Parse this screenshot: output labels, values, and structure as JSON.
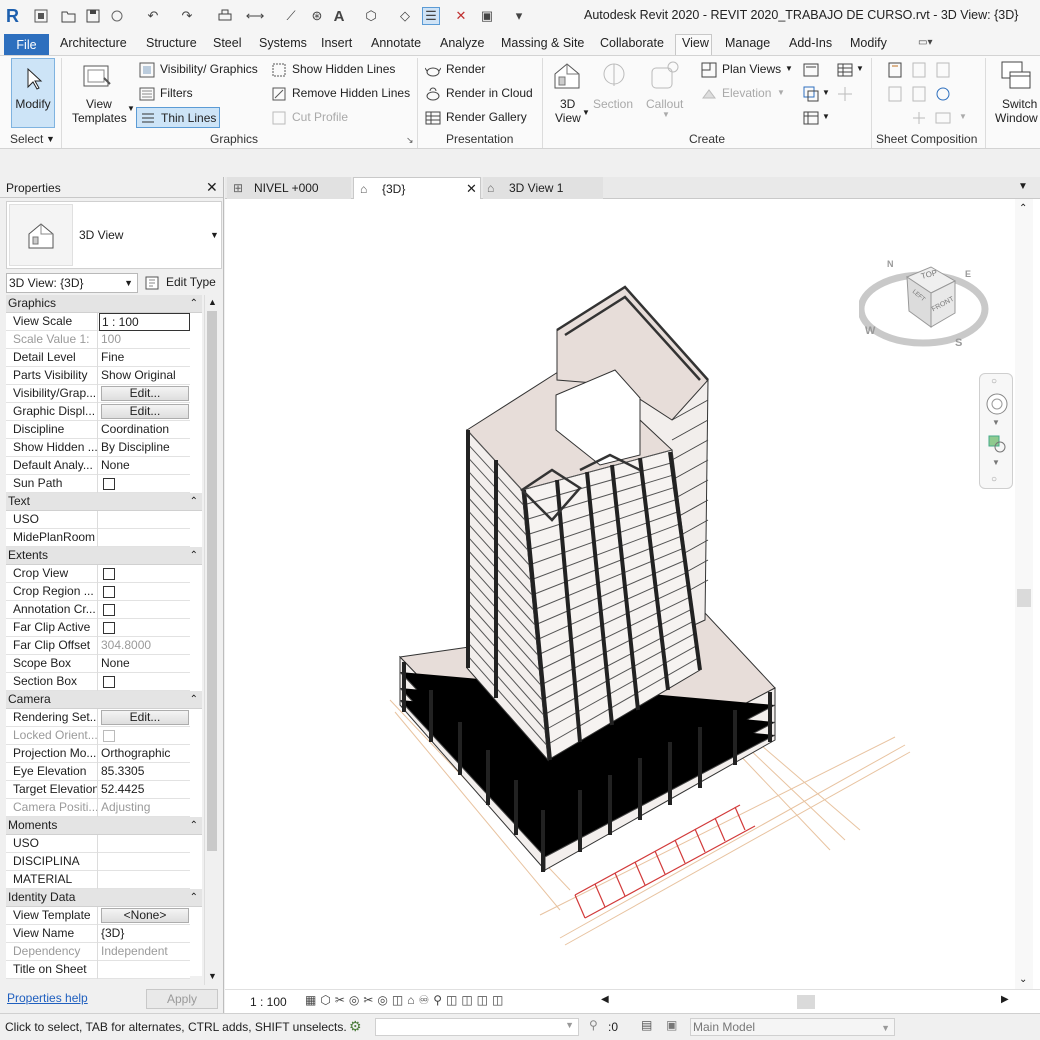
{
  "app": {
    "title": "Autodesk Revit 2020 - REVIT 2020_TRABAJO DE CURSO.rvt - 3D View: {3D}"
  },
  "ribbon_tabs": [
    "File",
    "Architecture",
    "Structure",
    "Steel",
    "Systems",
    "Insert",
    "Annotate",
    "Analyze",
    "Massing & Site",
    "Collaborate",
    "View",
    "Manage",
    "Add-Ins",
    "Modify"
  ],
  "ribbon": {
    "modify": "Modify",
    "select": "Select",
    "view_templates_1": "View",
    "view_templates_2": "Templates",
    "visibility_graphics": "Visibility/ Graphics",
    "filters": "Filters",
    "thin_lines": "Thin Lines",
    "show_hidden_lines": "Show  Hidden Lines",
    "remove_hidden_lines": "Remove  Hidden Lines",
    "cut_profile": "Cut  Profile",
    "graphics_panel": "Graphics",
    "render": "Render",
    "render_in_cloud": "Render  in Cloud",
    "render_gallery": "Render  Gallery",
    "presentation_panel": "Presentation",
    "view3d_1": "3D",
    "view3d_2": "View",
    "section": "Section",
    "callout": "Callout",
    "plan_views": "Plan  Views",
    "elevation": "Elevation",
    "create_panel": "Create",
    "sheet_composition": "Sheet Composition",
    "switch_1": "Switch",
    "switch_2": "Window"
  },
  "properties": {
    "title": "Properties",
    "type_name": "3D View",
    "selector": "3D View: {3D}",
    "edit_type": "Edit Type",
    "groups": {
      "graphics": "Graphics",
      "text": "Text",
      "extents": "Extents",
      "camera": "Camera",
      "moments": "Moments",
      "identity": "Identity Data"
    },
    "rows": {
      "view_scale": [
        "View Scale",
        "1 : 100"
      ],
      "scale_value": [
        "Scale Value    1:",
        "100"
      ],
      "detail_level": [
        "Detail Level",
        "Fine"
      ],
      "parts_visibility": [
        "Parts Visibility",
        "Show Original"
      ],
      "visibility_graphics": [
        "Visibility/Grap...",
        "Edit..."
      ],
      "graphic_display": [
        "Graphic Displ...",
        "Edit..."
      ],
      "discipline": [
        "Discipline",
        "Coordination"
      ],
      "show_hidden": [
        "Show Hidden ...",
        "By Discipline"
      ],
      "default_analysis": [
        "Default Analy...",
        "None"
      ],
      "sun_path": [
        "Sun Path",
        ""
      ],
      "uso": [
        "USO",
        ""
      ],
      "mideplan": [
        "MidePlanRoom",
        ""
      ],
      "crop_view": [
        "Crop View",
        ""
      ],
      "crop_region": [
        "Crop Region ...",
        ""
      ],
      "annotation_crop": [
        "Annotation Cr...",
        ""
      ],
      "far_clip_active": [
        "Far Clip Active",
        ""
      ],
      "far_clip_offset": [
        "Far Clip Offset",
        "304.8000"
      ],
      "scope_box": [
        "Scope Box",
        "None"
      ],
      "section_box": [
        "Section Box",
        ""
      ],
      "rendering_settings": [
        "Rendering Set...",
        "Edit..."
      ],
      "locked_orientation": [
        "Locked Orient...",
        ""
      ],
      "projection_mode": [
        "Projection Mo...",
        "Orthographic"
      ],
      "eye_elevation": [
        "Eye Elevation",
        "85.3305"
      ],
      "target_elevation": [
        "Target Elevation",
        "52.4425"
      ],
      "camera_position": [
        "Camera Positi...",
        "Adjusting"
      ],
      "m_uso": [
        "USO",
        ""
      ],
      "m_disciplina": [
        "DISCIPLINA",
        ""
      ],
      "m_material": [
        "MATERIAL",
        ""
      ],
      "view_template": [
        "View Template",
        "<None>"
      ],
      "view_name": [
        "View Name",
        "{3D}"
      ],
      "dependency": [
        "Dependency",
        "Independent"
      ],
      "title_on_sheet": [
        "Title on Sheet",
        ""
      ]
    },
    "help": "Properties help",
    "apply": "Apply"
  },
  "doc_tabs": [
    "NIVEL +000",
    "{3D}",
    "3D View 1"
  ],
  "view_controls": {
    "scale": "1 : 100"
  },
  "viewcube": {
    "top": "TOP",
    "front": "FRONT",
    "left": "LEFT",
    "n": "N",
    "e": "E",
    "s": "S",
    "w": "W"
  },
  "status": {
    "message": "Click to select, TAB for alternates, CTRL adds, SHIFT unselects.",
    "count": ":0",
    "model": "Main Model"
  }
}
